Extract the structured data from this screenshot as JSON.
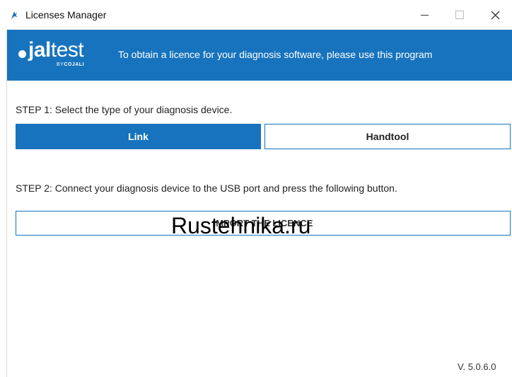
{
  "window": {
    "title": "Licenses Manager",
    "controls": {
      "minimize": "—",
      "maximize": "",
      "close": "✕"
    }
  },
  "banner": {
    "logo_prefix": "jal",
    "logo_suffix": "test",
    "logo_sub_by": "BY",
    "logo_sub_brand": "COJALI",
    "message": "To obtain a licence for your diagnosis software, please use this program",
    "background": "#1773bd"
  },
  "step1": {
    "label": "STEP 1: Select the type of your diagnosis device.",
    "options": [
      {
        "label": "Link",
        "selected": true
      },
      {
        "label": "Handtool",
        "selected": false
      }
    ]
  },
  "step2": {
    "label": "STEP 2: Connect your diagnosis device to the USB port and press the following button.",
    "button_label": "IMPORT THE LICENCE"
  },
  "watermark": {
    "text": "Rustehnika.ru"
  },
  "footer": {
    "version": "V. 5.0.6.0"
  },
  "icons": {
    "app": "jaltest-app-icon"
  },
  "colors": {
    "accent": "#1773bd"
  }
}
